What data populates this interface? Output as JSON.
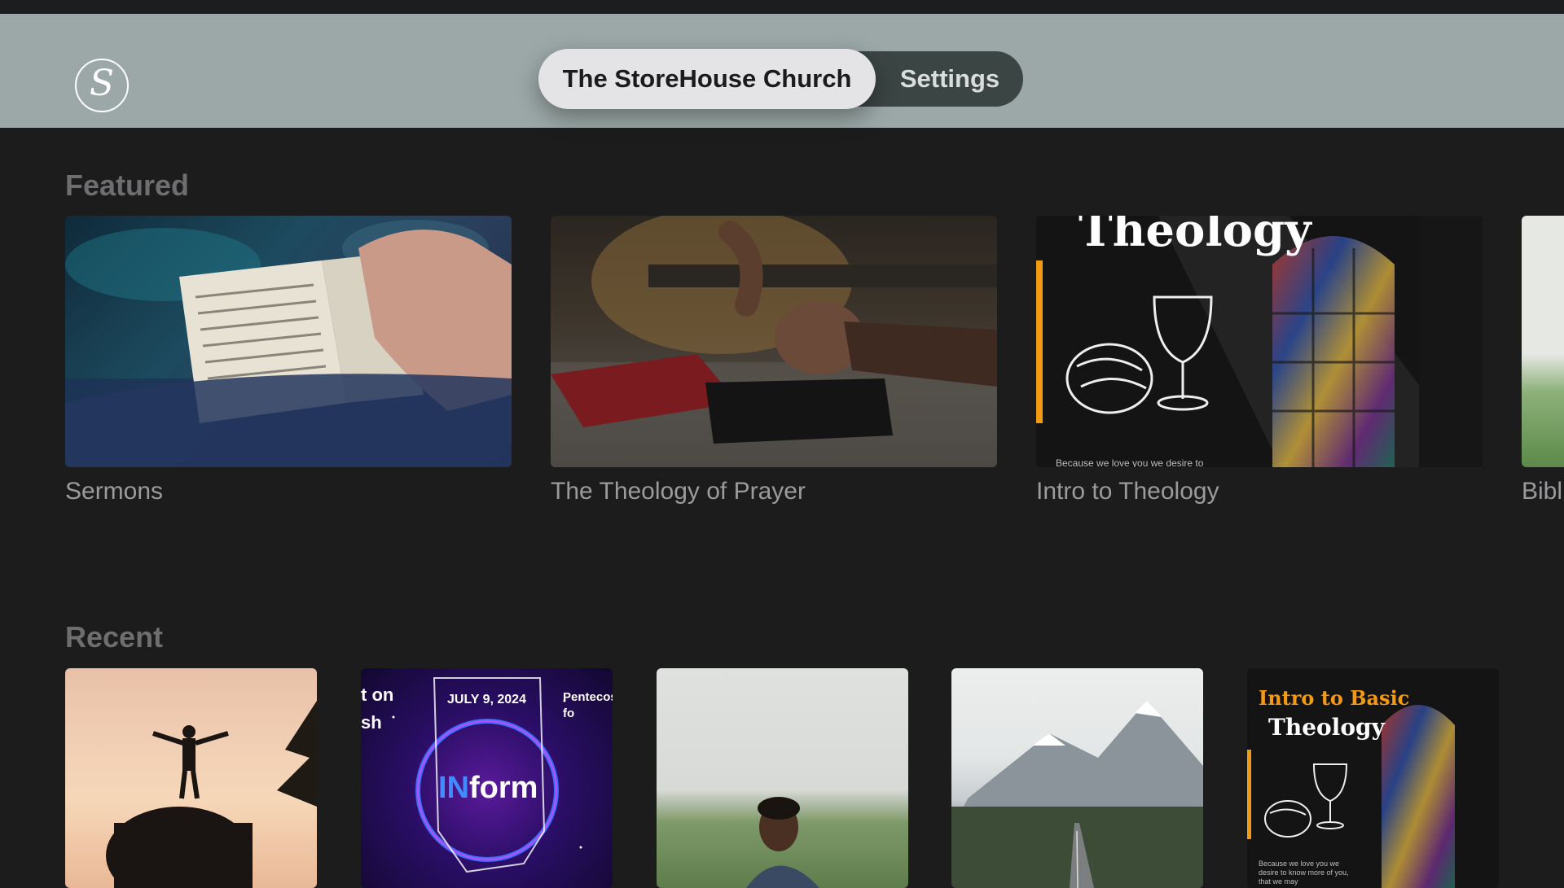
{
  "header": {
    "logo_letter": "S",
    "tabs": [
      {
        "label": "The StoreHouse Church",
        "selected": true
      },
      {
        "label": "Settings",
        "selected": false
      }
    ]
  },
  "featured": {
    "title": "Featured",
    "items": [
      {
        "title": "Sermons",
        "image": "open-bible-photo"
      },
      {
        "title": "The Theology of Prayer",
        "image": "praying-hands-guitar-photo"
      },
      {
        "title": "Intro to Theology",
        "image": "theology-bread-cup-graphic",
        "overlay_title": "Theology",
        "overlay_caption": "Because we love you we desire to"
      },
      {
        "title": "Bibl",
        "image": "green-field-photo"
      }
    ]
  },
  "recent": {
    "title": "Recent",
    "items": [
      {
        "image": "silhouette-sunset-photo"
      },
      {
        "image": "inform-graphic",
        "overlay_left": "t on\nsh",
        "overlay_date": "JULY 9, 2024",
        "overlay_brand_in": "IN",
        "overlay_brand_form": "form",
        "overlay_side": "Pentecos\nfo"
      },
      {
        "image": "man-in-field-photo"
      },
      {
        "image": "mountain-road-photo"
      },
      {
        "image": "intro-basic-theology-graphic",
        "overlay_title_1": "Intro to Basic",
        "overlay_title_2": "Theology",
        "overlay_caption": "Because we love you we desire to know more of you, that we may"
      }
    ]
  },
  "colors": {
    "background": "#1c1c1d",
    "header": "#9ba8a7",
    "tab_active": "#e4e4e6",
    "tab_bar": "#3b4544",
    "accent_orange": "#f29a12"
  }
}
